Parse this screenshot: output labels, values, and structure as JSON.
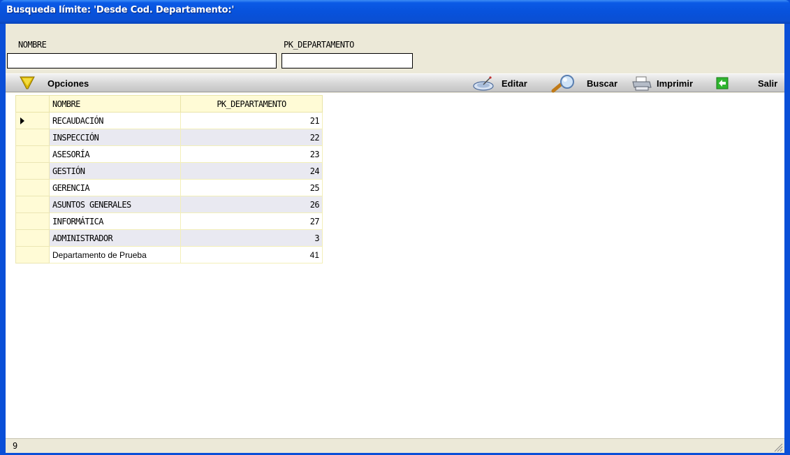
{
  "window": {
    "title": "Busqueda límite: 'Desde Cod. Departamento:'"
  },
  "filters": {
    "nombre_label": "NOMBRE",
    "nombre_value": "",
    "pk_label": "PK_DEPARTAMENTO",
    "pk_value": ""
  },
  "toolbar": {
    "options_label": "Opciones",
    "edit_label": "Editar",
    "search_label": "Buscar",
    "print_label": "Imprimir",
    "exit_label": "Salir"
  },
  "grid": {
    "columns": [
      "NOMBRE",
      "PK_DEPARTAMENTO"
    ],
    "rows": [
      {
        "nombre": "RECAUDACIÓN",
        "pk": "21"
      },
      {
        "nombre": "INSPECCIÓN",
        "pk": "22"
      },
      {
        "nombre": "ASESORÍA",
        "pk": "23"
      },
      {
        "nombre": "GESTIÓN",
        "pk": "24"
      },
      {
        "nombre": "GERENCIA",
        "pk": "25"
      },
      {
        "nombre": "ASUNTOS GENERALES",
        "pk": "26"
      },
      {
        "nombre": "INFORMÁTICA",
        "pk": "27"
      },
      {
        "nombre": "ADMINISTRADOR",
        "pk": "3"
      },
      {
        "nombre": "Departamento de Prueba",
        "pk": "41"
      }
    ]
  },
  "status": {
    "record_count": "9"
  },
  "icons": {
    "options": "funnel-icon",
    "edit": "satellite-dish-icon",
    "search": "magnifier-icon",
    "print": "printer-icon",
    "exit": "exit-door-icon"
  },
  "colors": {
    "title_bar": "#0a52dc",
    "grid_header": "#fffbd6",
    "grid_alt_row": "#e9e9f1",
    "exit_icon": "#2fb52f"
  }
}
